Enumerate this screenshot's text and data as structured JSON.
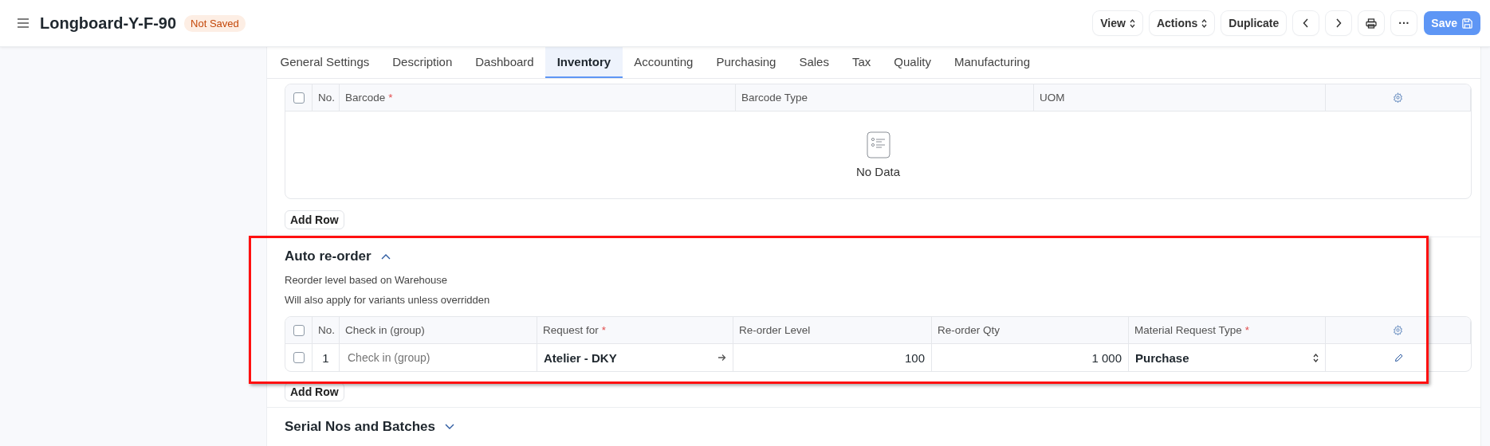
{
  "header": {
    "title": "Longboard-Y-F-90",
    "status": "Not Saved",
    "buttons": [
      {
        "kind": "dropdown",
        "label": "View"
      },
      {
        "kind": "dropdown",
        "label": "Actions"
      },
      {
        "kind": "text",
        "label": "Duplicate"
      },
      {
        "kind": "prev"
      },
      {
        "kind": "next"
      },
      {
        "kind": "print"
      },
      {
        "kind": "more",
        "label": "···"
      },
      {
        "kind": "save",
        "label": "Save"
      }
    ]
  },
  "tabs": [
    {
      "label": "General Settings",
      "selected": false
    },
    {
      "label": "Description",
      "selected": false
    },
    {
      "label": "Dashboard",
      "selected": false
    },
    {
      "label": "Inventory",
      "selected": true
    },
    {
      "label": "Accounting",
      "selected": false
    },
    {
      "label": "Purchasing",
      "selected": false
    },
    {
      "label": "Sales",
      "selected": false
    },
    {
      "label": "Tax",
      "selected": false
    },
    {
      "label": "Quality",
      "selected": false
    },
    {
      "label": "Manufacturing",
      "selected": false
    }
  ],
  "barcodes": {
    "all_checked": false,
    "no_label": "No.",
    "columns": [
      {
        "label": "Barcode",
        "mark": "*"
      },
      {
        "label": "Barcode Type"
      },
      {
        "label": "UOM"
      }
    ],
    "empty_text": "No Data",
    "add_row": "Add Row"
  },
  "auto_reorder": {
    "title": "Auto re-order",
    "expanded": true,
    "notes": [
      "Reorder level based on Warehouse",
      "Will also apply for variants unless overridden"
    ],
    "all_checked": false,
    "no_label": "No.",
    "columns": [
      {
        "label": "Check in (group)"
      },
      {
        "label": "Request for",
        "mark": "*"
      },
      {
        "label": "Re-order Level"
      },
      {
        "label": "Re-order Qty"
      },
      {
        "label": "Material Request Type",
        "mark": "*"
      }
    ],
    "rows": [
      {
        "checked": false,
        "no": "1",
        "check_in": {
          "placeholder": "Check in (group)"
        },
        "request_for": "Atelier - DKY",
        "level": "100",
        "qty": "1 000",
        "type": "Purchase"
      }
    ],
    "add_row": "Add Row"
  },
  "serial_section": {
    "title": "Serial Nos and Batches",
    "expanded": false
  }
}
